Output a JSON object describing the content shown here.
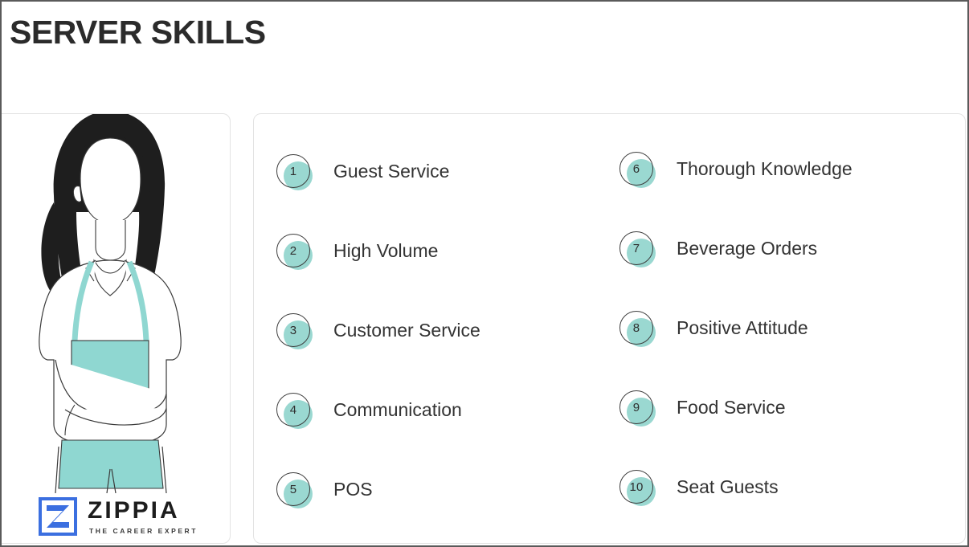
{
  "page": {
    "title": "SERVER SKILLS",
    "accent_teal": "#9AD8D1",
    "illustration_teal": "#8FD7D1",
    "title_color": "#2B2B2B",
    "panel_border_color": "#E3E3E3",
    "outer_border_color": "#5A5A5A"
  },
  "illustration": {
    "name": "server-illustration",
    "description": "Line-art illustration of a woman server with dark hair, white collared shirt, teal apron and arms crossed",
    "hair_color": "#1E1E1E",
    "apron_color": "#8FD7D1",
    "line_color": "#3A3A3A",
    "shirt_color": "#FFFFFF"
  },
  "logo": {
    "mark_name": "zippia-z-mark",
    "mark_color": "#3B6FE0",
    "wordmark": "ZIPPIA",
    "tagline": "THE CAREER EXPERT"
  },
  "skills": {
    "left_column": [
      {
        "number": "1",
        "label": "Guest Service"
      },
      {
        "number": "2",
        "label": "High Volume"
      },
      {
        "number": "3",
        "label": "Customer Service"
      },
      {
        "number": "4",
        "label": "Communication"
      },
      {
        "number": "5",
        "label": "POS"
      }
    ],
    "right_column": [
      {
        "number": "6",
        "label": "Thorough Knowledge"
      },
      {
        "number": "7",
        "label": "Beverage Orders"
      },
      {
        "number": "8",
        "label": "Positive Attitude"
      },
      {
        "number": "9",
        "label": "Food Service"
      },
      {
        "number": "10",
        "label": "Seat Guests"
      }
    ]
  }
}
